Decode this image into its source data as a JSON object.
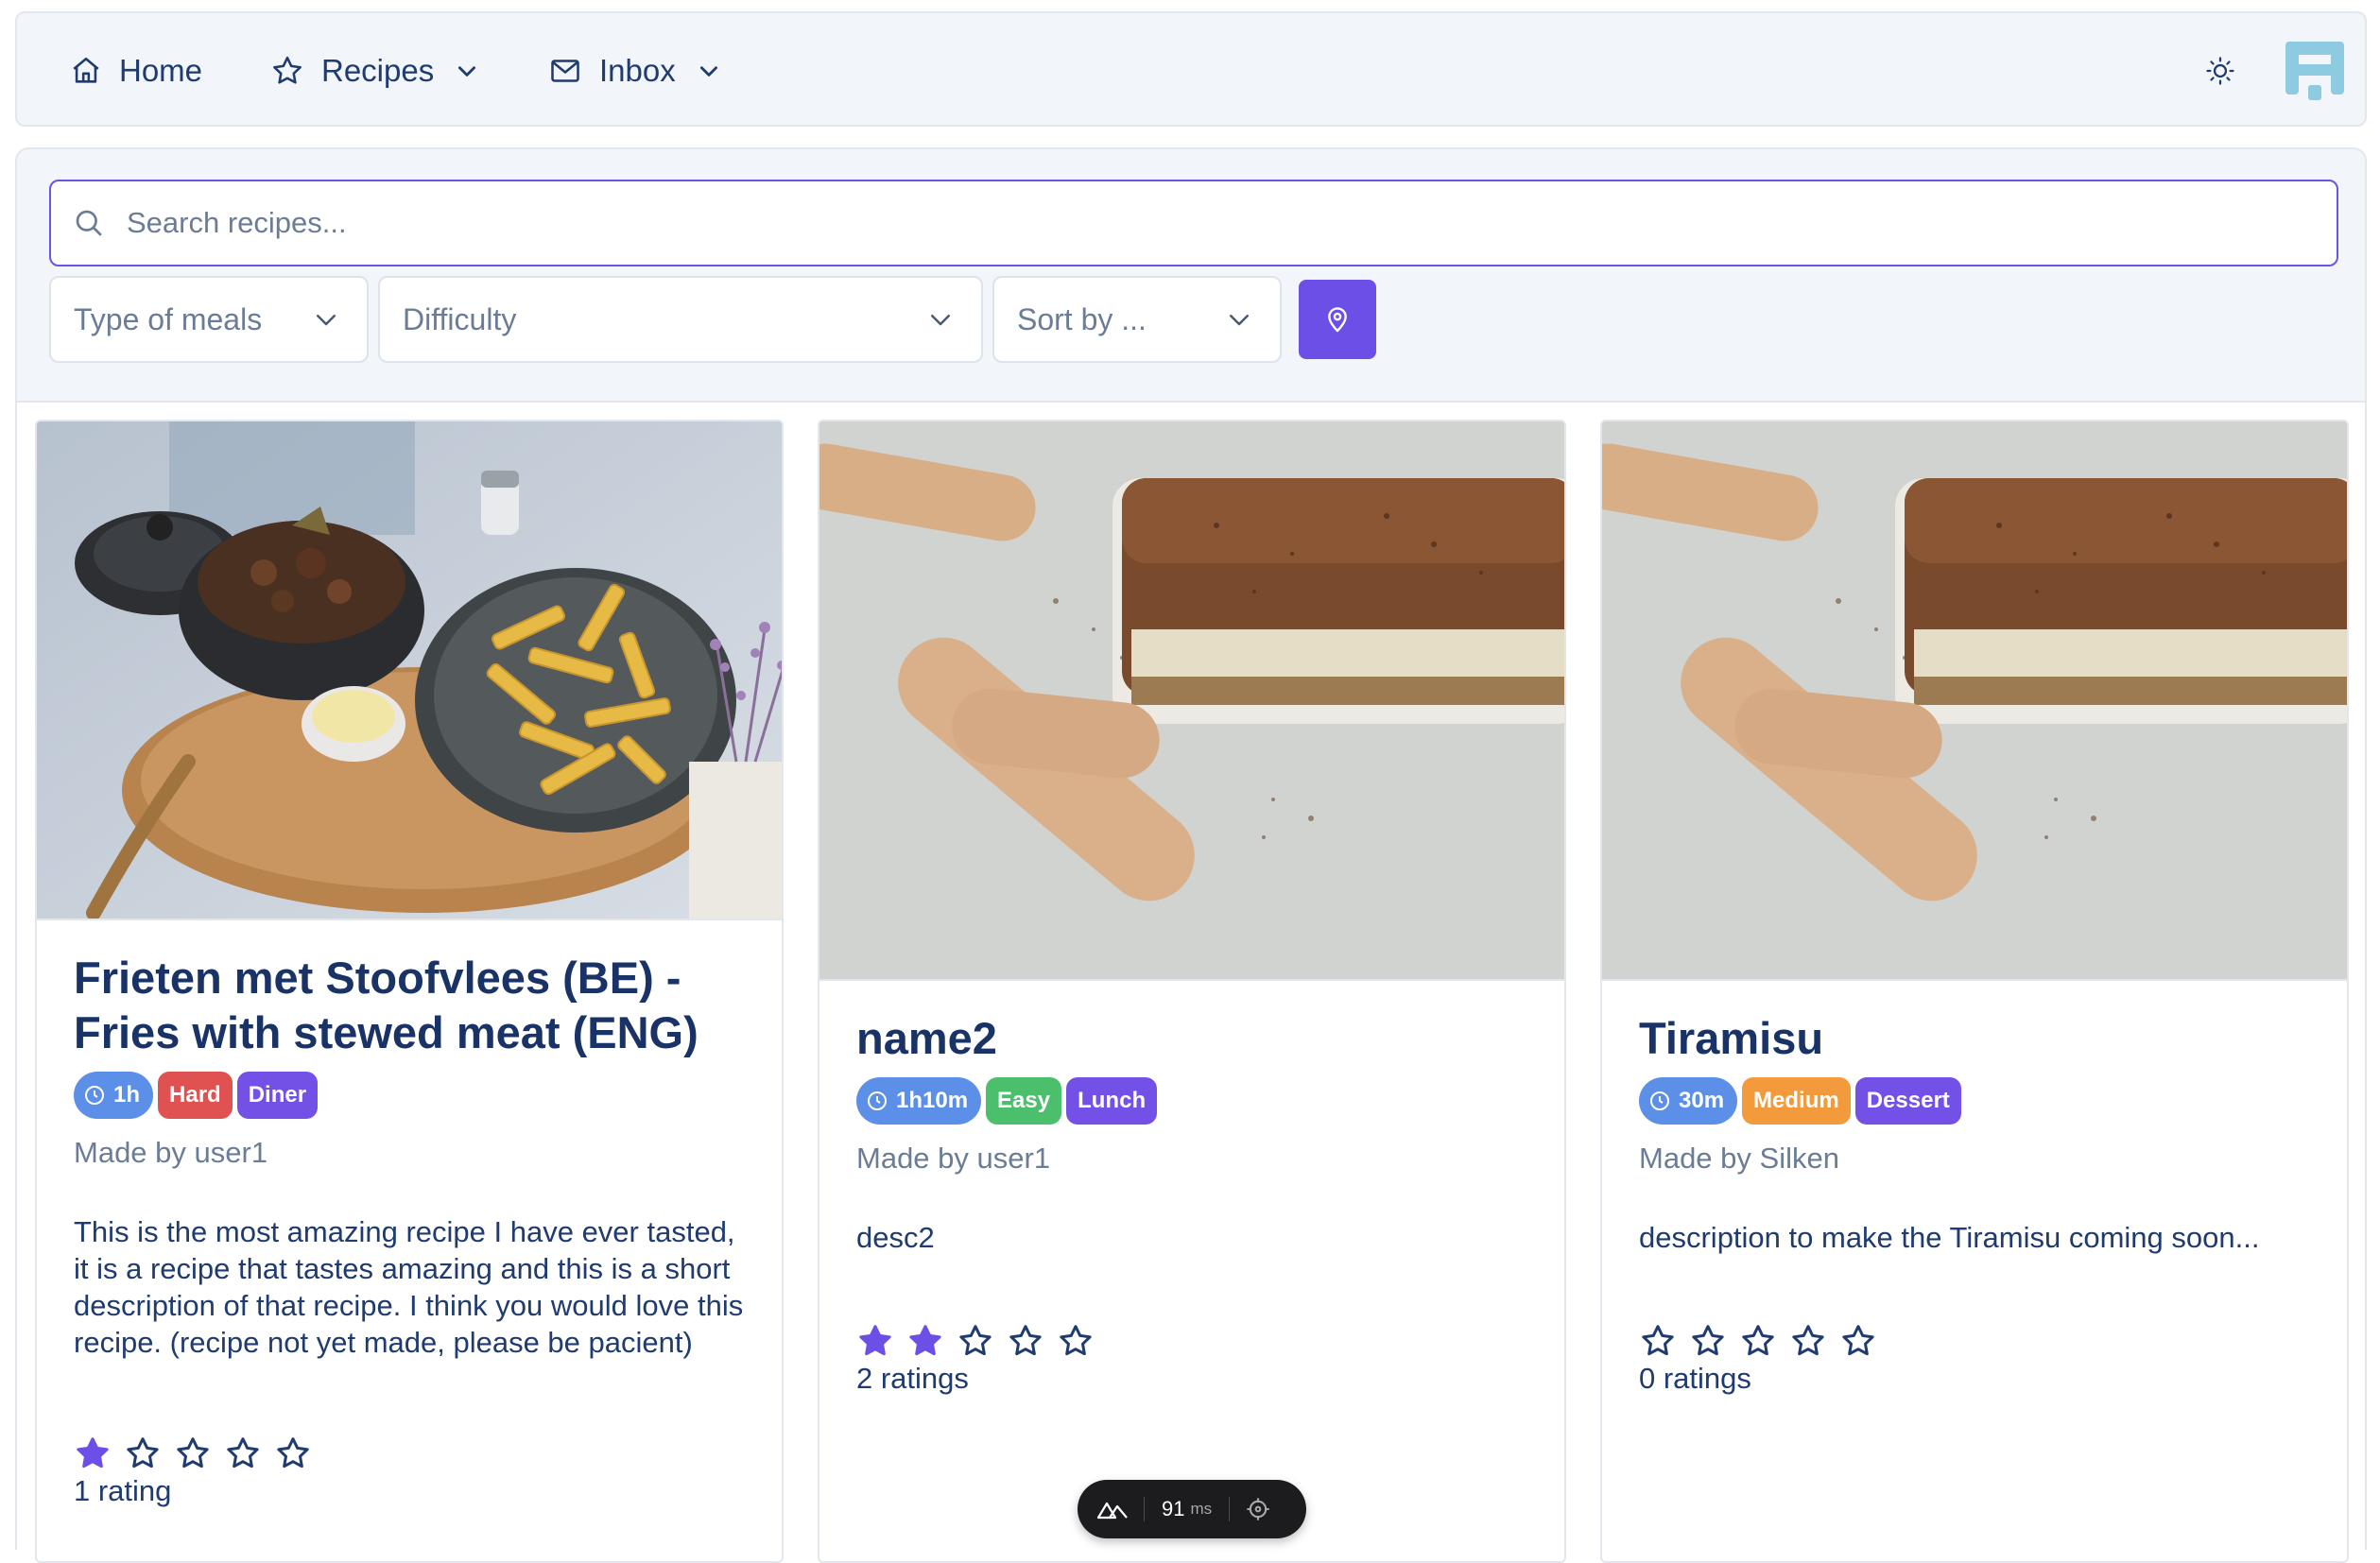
{
  "navbar": {
    "home_label": "Home",
    "recipes_label": "Recipes",
    "inbox_label": "Inbox"
  },
  "search": {
    "placeholder": "Search recipes..."
  },
  "filters": {
    "meal_type": "Type of meals",
    "difficulty": "Difficulty",
    "sort": "Sort by ..."
  },
  "recipes": [
    {
      "title": "Frieten met Stoofvlees (BE) - Fries with stewed meat (ENG)",
      "time": "1h",
      "difficulty": "Hard",
      "meal": "Diner",
      "author": "Made by user1",
      "description": "This is the most amazing recipe I have ever tasted, it is a recipe that tastes amazing and this is a short description of that recipe. I think you would love this recipe. (recipe not yet made, please be pacient)",
      "stars_filled": 1,
      "ratings": "1 rating"
    },
    {
      "title": "name2",
      "time": "1h10m",
      "difficulty": "Easy",
      "meal": "Lunch",
      "author": "Made by user1",
      "description": "desc2",
      "stars_filled": 2,
      "ratings": "2 ratings"
    },
    {
      "title": "Tiramisu",
      "time": "30m",
      "difficulty": "Medium",
      "meal": "Dessert",
      "author": "Made by Silken",
      "description": "description to make the Tiramisu coming soon...",
      "stars_filled": 0,
      "ratings": "0 ratings"
    }
  ],
  "devtools": {
    "ms_value": "91",
    "ms_unit": "ms"
  },
  "colors": {
    "accent": "#6c4fe6",
    "star_filled": "#6c4fe6",
    "time_badge": "#5b8fe8",
    "hard": "#e05252",
    "easy": "#4bbf6b",
    "medium": "#f39a3c",
    "meal": "#7451e6"
  }
}
